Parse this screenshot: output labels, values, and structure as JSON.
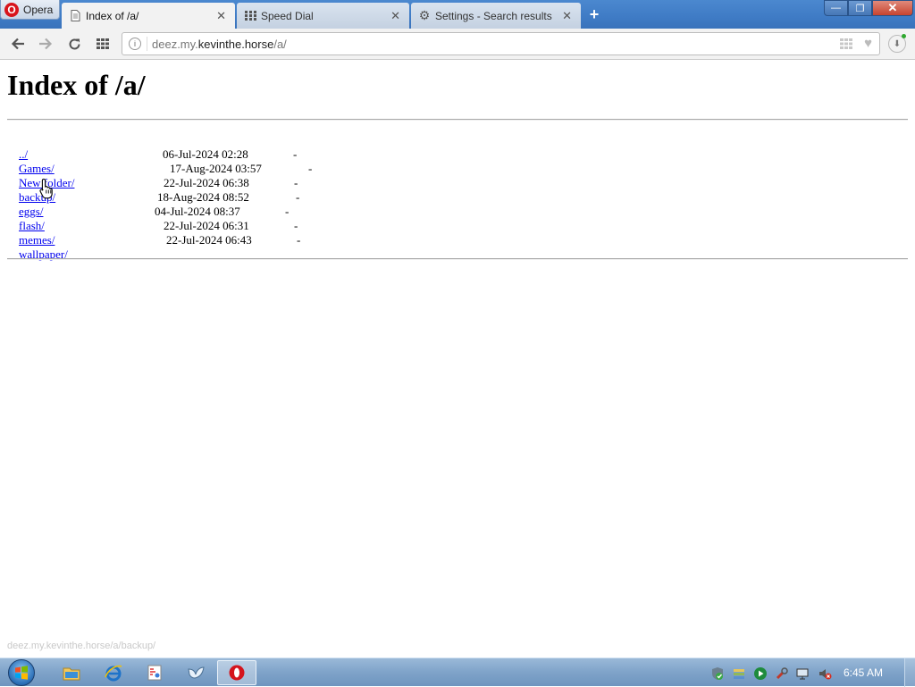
{
  "browser": {
    "menu_label": "Opera",
    "tabs": [
      {
        "title": "Index of /a/",
        "icon": "document-icon",
        "active": true
      },
      {
        "title": "Speed Dial",
        "icon": "speed-dial-icon",
        "active": false
      },
      {
        "title": "Settings - Search results",
        "icon": "gear-icon",
        "active": false
      }
    ],
    "new_tab_label": "+",
    "window_controls": {
      "minimize": "—",
      "maximize": "❐",
      "close": "✕"
    },
    "address": {
      "host_prefix": "deez.my.",
      "host_domain": "kevinthe.horse",
      "path": "/a/"
    }
  },
  "page": {
    "heading": "Index of /a/",
    "parent_link": "../",
    "entries": [
      {
        "name": "Games/",
        "date": "06-Jul-2024 02:28",
        "size": "-"
      },
      {
        "name": "New folder/",
        "date": "17-Aug-2024 03:57",
        "size": "-"
      },
      {
        "name": "backup/",
        "date": "22-Jul-2024 06:38",
        "size": "-"
      },
      {
        "name": "eggs/",
        "date": "18-Aug-2024 08:52",
        "size": "-"
      },
      {
        "name": "flash/",
        "date": "04-Jul-2024 08:37",
        "size": "-"
      },
      {
        "name": "memes/",
        "date": "22-Jul-2024 06:31",
        "size": "-"
      },
      {
        "name": "wallpaper/",
        "date": "22-Jul-2024 06:43",
        "size": "-"
      }
    ],
    "status_url": "deez.my.kevinthe.horse/a/backup/"
  },
  "taskbar": {
    "pinned": [
      "file-explorer-icon",
      "internet-explorer-icon",
      "paint-icon",
      "bird-app-icon",
      "opera-icon"
    ],
    "tray": [
      "security-shield-icon",
      "network-stack-icon",
      "media-play-icon",
      "tool-icon",
      "display-icon",
      "volume-muted-icon"
    ],
    "clock": "6:45 AM"
  }
}
